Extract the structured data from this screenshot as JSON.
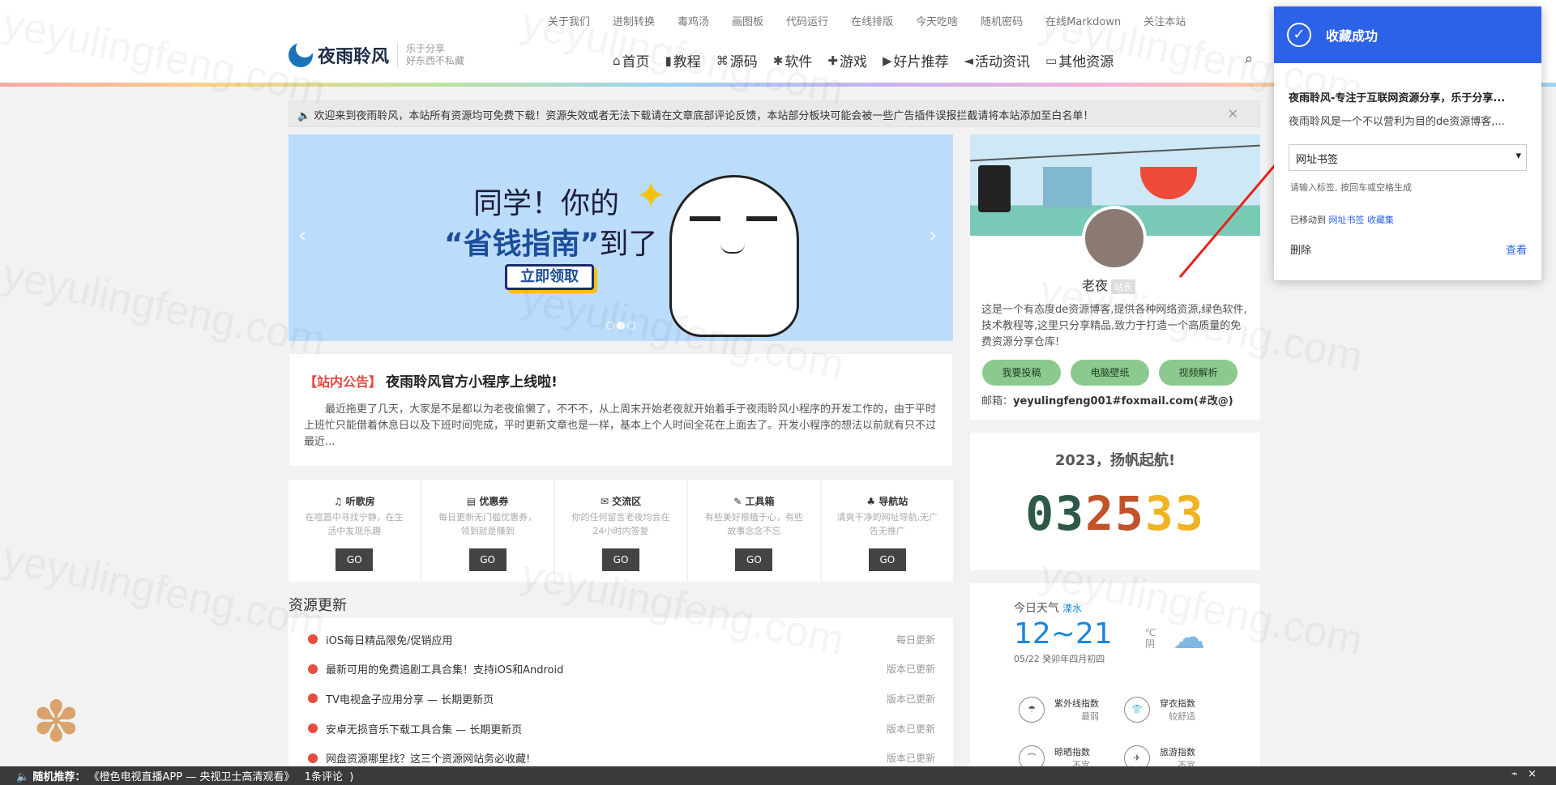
{
  "topnav": [
    "关于我们",
    "进制转换",
    "毒鸡汤",
    "画图板",
    "代码运行",
    "在线排版",
    "今天吃啥",
    "随机密码",
    "在线Markdown",
    "关注本站"
  ],
  "logo": {
    "name": "夜雨聆风",
    "slogan1": "乐于分享",
    "slogan2": "好东西不私藏"
  },
  "mainnav": [
    {
      "icon": "⌂",
      "label": "首页"
    },
    {
      "icon": "▮",
      "label": "教程"
    },
    {
      "icon": "⌘",
      "label": "源码"
    },
    {
      "icon": "✱",
      "label": "软件"
    },
    {
      "icon": "✚",
      "label": "游戏"
    },
    {
      "icon": "▶",
      "label": "好片推荐"
    },
    {
      "icon": "◄",
      "label": "活动资讯"
    },
    {
      "icon": "▭",
      "label": "其他资源"
    }
  ],
  "notice": "欢迎来到夜雨聆风，本站所有资源均可免费下载！资源失效或者无法下载请在文章底部评论反馈，本站部分板块可能会被一些广告插件误报拦截请将本站添加至白名单！",
  "slider": {
    "line1": "同学！你的",
    "line2a": "“省钱指南”",
    "line2b": "到了",
    "button": "立即领取"
  },
  "announce": {
    "tag": "【站内公告】",
    "title": "夜雨聆风官方小程序上线啦!",
    "body": "最近拖更了几天，大家是不是都以为老夜偷懒了，不不不，从上周末开始老夜就开始着手于夜雨聆风小程序的开发工作的，由于平时上班忙只能借着休息日以及下班时间完成，平时更新文章也是一样，基本上个人时间全花在上面去了。开发小程序的想法以前就有只不过最近..."
  },
  "tools": [
    {
      "icon": "♫",
      "title": "听歌房",
      "desc": "在喧嚣中寻找宁静，在生活中发现乐趣",
      "go": "GO"
    },
    {
      "icon": "▤",
      "title": "优惠券",
      "desc": "每日更新无门槛优惠券，领到就是赚到",
      "go": "GO"
    },
    {
      "icon": "✉",
      "title": "交流区",
      "desc": "你的任何留言老夜均会在24小时内答复",
      "go": "GO"
    },
    {
      "icon": "✎",
      "title": "工具箱",
      "desc": "有些美好根植于心，有些故事念念不忘",
      "go": "GO"
    },
    {
      "icon": "♣",
      "title": "导航站",
      "desc": "清爽干净的网址导航,无广告无推广",
      "go": "GO"
    }
  ],
  "resources": {
    "title": "资源更新",
    "items": [
      {
        "title": "iOS每日精品限免/促销应用",
        "badge": "每日更新"
      },
      {
        "title": "最新可用的免费追剧工具合集！支持iOS和Android",
        "badge": "版本已更新"
      },
      {
        "title": "TV电视盒子应用分享 — 长期更新页",
        "badge": "版本已更新"
      },
      {
        "title": "安卓无损音乐下载工具合集 — 长期更新页",
        "badge": "版本已更新"
      },
      {
        "title": "网盘资源哪里找？这三个资源网站务必收藏!",
        "badge": "版本已更新"
      }
    ]
  },
  "profile": {
    "name": "老夜",
    "badge": "站长",
    "desc": "这是一个有态度de资源博客,提供各种网络资源,绿色软件,技术教程等,这里只分享精品,致力于打造一个高质量的免费资源分享仓库!",
    "btn1": "我要投稿",
    "btn2": "电脑壁纸",
    "btn3": "视频解析",
    "mail_label": "邮箱：",
    "mail": "yeyulingfeng001#foxmail.com(#改@)"
  },
  "counter": {
    "heading": "2023，扬帆起航!",
    "digits": "032533",
    "colors": [
      "#2e5a45",
      "#2e5a45",
      "#c0532a",
      "#c0532a",
      "#f0b323",
      "#f0b323"
    ]
  },
  "weather": {
    "label": "今日天气",
    "city": "溧水",
    "temp": "12~21",
    "unit": "℃",
    "cond": "阴",
    "date": "05/22 癸卯年四月初四",
    "indices": [
      {
        "name": "紫外线指数",
        "value": "最弱"
      },
      {
        "name": "穿衣指数",
        "value": "较舒适"
      },
      {
        "name": "晾晒指数",
        "value": "不宜"
      },
      {
        "name": "旅游指数",
        "value": "不宜"
      }
    ]
  },
  "popup": {
    "header": "收藏成功",
    "title": "夜雨聆风-专注于互联网资源分享，乐于分享...",
    "desc": "夜雨聆风是一个不以营利为目的de资源博客,...",
    "folder": "网址书签",
    "hint": "请输入标签, 按回车或空格生成",
    "moved_prefix": "已移动到",
    "moved_folder": "网址书签",
    "moved_suffix": "收藏集",
    "delete": "删除",
    "view": "查看"
  },
  "bottombar": {
    "label": "随机推荐：",
    "text": "《橙色电视直播APP — 央视卫士高清观看》",
    "comments": "1条评论",
    "close": "×"
  },
  "watermark": "yeyulingfeng.com"
}
